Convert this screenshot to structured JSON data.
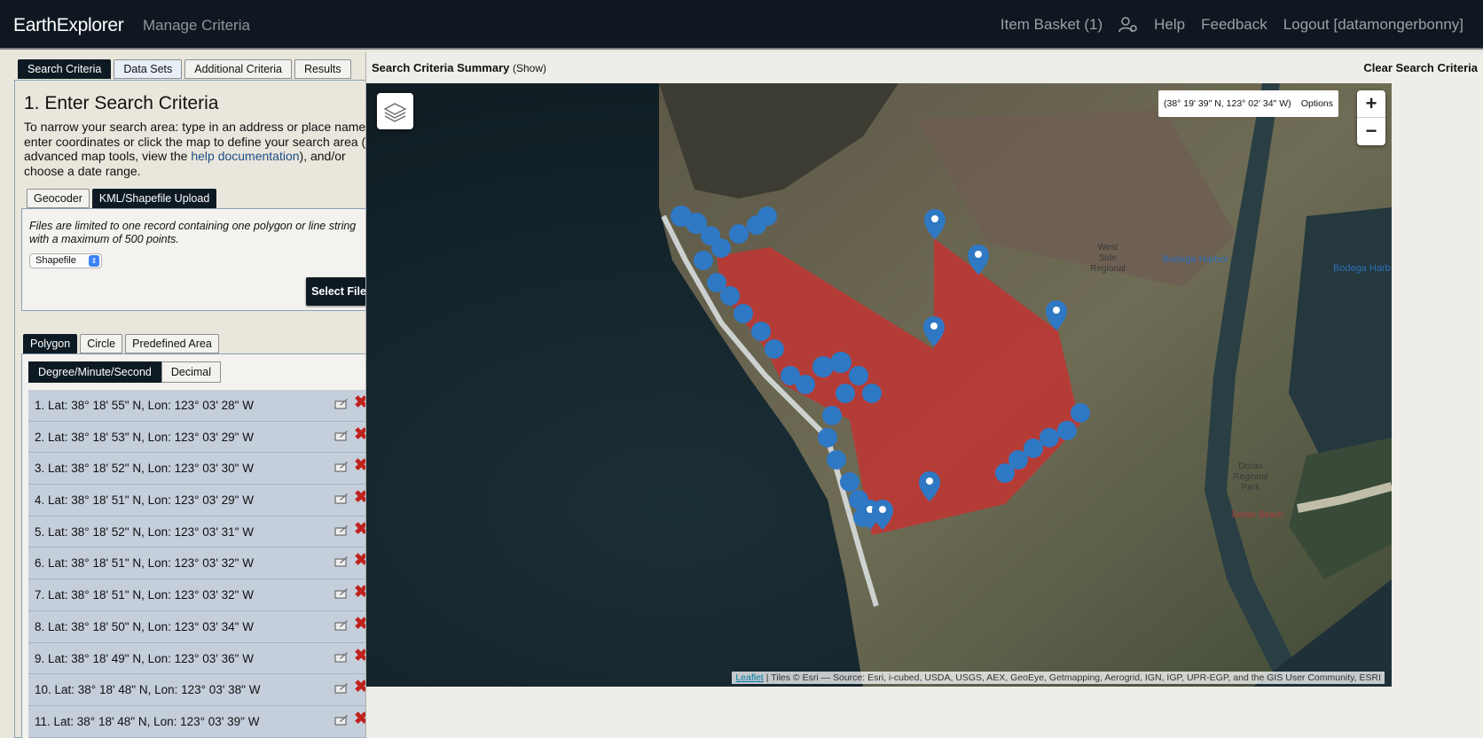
{
  "header": {
    "brand": "EarthExplorer",
    "manage": "Manage Criteria",
    "item_basket": "Item Basket (1)",
    "help": "Help",
    "feedback": "Feedback",
    "logout": "Logout [datamongerbonny]"
  },
  "tabs": [
    "Search Criteria",
    "Data Sets",
    "Additional Criteria",
    "Results"
  ],
  "search": {
    "title": "1. Enter Search Criteria",
    "intro_before": "To narrow your search area: type in an address or place name, enter coordinates or click the map to define your search area (for advanced map tools, view the ",
    "intro_link": "help documentation",
    "intro_after": "), and/or choose a date range."
  },
  "subtabs": [
    "Geocoder",
    "KML/Shapefile Upload"
  ],
  "upload": {
    "note": "Files are limited to one record containing one polygon or line string with a maximum of 500 points.",
    "file_type": "Shapefile",
    "select_file": "Select File"
  },
  "shape_tabs": [
    "Polygon",
    "Circle",
    "Predefined Area"
  ],
  "format_tabs": [
    "Degree/Minute/Second",
    "Decimal"
  ],
  "coordinates": [
    "1.  Lat: 38° 18' 55\" N, Lon: 123° 03' 28\" W",
    "2.  Lat: 38° 18' 53\" N, Lon: 123° 03' 29\" W",
    "3.  Lat: 38° 18' 52\" N, Lon: 123° 03' 30\" W",
    "4.  Lat: 38° 18' 51\" N, Lon: 123° 03' 29\" W",
    "5.  Lat: 38° 18' 52\" N, Lon: 123° 03' 31\" W",
    "6.  Lat: 38° 18' 51\" N, Lon: 123° 03' 32\" W",
    "7.  Lat: 38° 18' 51\" N, Lon: 123° 03' 32\" W",
    "8.  Lat: 38° 18' 50\" N, Lon: 123° 03' 34\" W",
    "9.  Lat: 38° 18' 49\" N, Lon: 123° 03' 36\" W",
    "10.  Lat: 38° 18' 48\" N, Lon: 123° 03' 38\" W",
    "11.  Lat: 38° 18' 48\" N, Lon: 123° 03' 39\" W"
  ],
  "map": {
    "summary_title": "Search Criteria Summary",
    "summary_show": "(Show)",
    "clear": "Clear Search Criteria",
    "cursor_coords": "(38° 19' 39\" N, 123° 02' 34\" W)",
    "options": "Options",
    "zoom_in": "+",
    "zoom_out": "−",
    "labels": [
      "West Side Regional Park",
      "Bodega Harbor",
      "Bodega Harb",
      "Doran Regional Park",
      "Doran Beach"
    ],
    "attribution_link": "Leaflet",
    "attribution_text": " | Tiles © Esri — Source: Esri, i-cubed, USDA, USGS, AEX, GeoEye, Getmapping, Aerogrid, IGN, IGP, UPR-EGP, and the GIS User Community, ESRI"
  },
  "colors": {
    "header_bg": "#0f1820",
    "polygon": "#b83a36",
    "marker": "#2f78c4"
  }
}
